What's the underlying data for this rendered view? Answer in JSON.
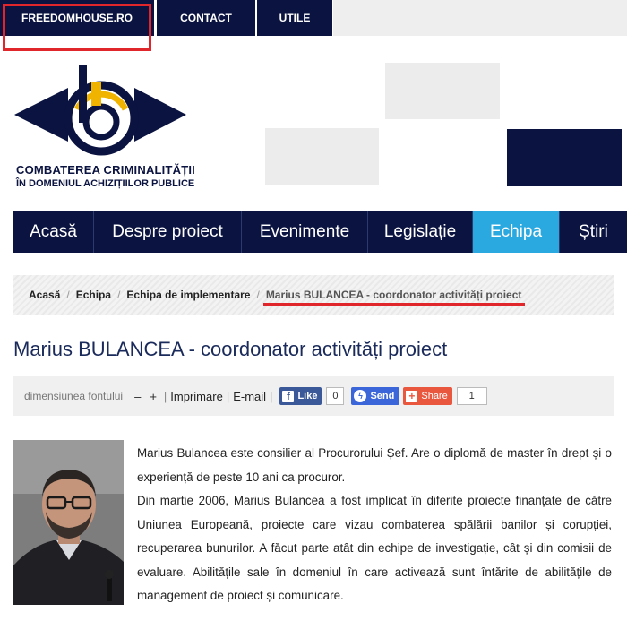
{
  "topnav": {
    "items": [
      "FREEDOMHOUSE.RO",
      "CONTACT",
      "UTILE"
    ]
  },
  "logo": {
    "line1": "COMBATEREA CRIMINALITĂȚII",
    "line2": "ÎN DOMENIUL ACHIZIȚIILOR PUBLICE"
  },
  "mainnav": {
    "items": [
      "Acasă",
      "Despre proiect",
      "Evenimente",
      "Legislație",
      "Echipa",
      "Știri"
    ],
    "active": "Echipa"
  },
  "breadcrumb": {
    "items": [
      "Acasă",
      "Echipa",
      "Echipa de implementare"
    ],
    "current": "Marius BULANCEA - coordonator activități proiect"
  },
  "page": {
    "title": "Marius BULANCEA - coordonator activități proiect"
  },
  "toolbar": {
    "font_size_label": "dimensiunea fontului",
    "decrease": "–",
    "increase": "+",
    "print": "Imprimare",
    "email": "E-mail",
    "like_label": "Like",
    "like_count": "0",
    "send_label": "Send",
    "share_label": "Share",
    "share_count": "1"
  },
  "bio": {
    "p1": "Marius Bulancea este consilier al Procurorului Șef.  Are o diplomă de master în drept și o experiență de peste 10 ani ca procuror.",
    "p2": "Din martie 2006, Marius Bulancea a fost implicat în diferite proiecte finanțate de către Uniunea Europeană, proiecte care vizau combaterea spălării banilor și corupției, recuperarea bunurilor. A făcut parte atât din echipe de investigație, cât și din comisii de evaluare. Abilitățile sale în domeniul în care activează sunt întărite de abilitățile de management de proiect și comunicare."
  },
  "colors": {
    "navy": "#0b1340",
    "active_tab": "#2aa8e0",
    "annotation_red": "#e0262a",
    "logo_gold": "#f0b400"
  }
}
